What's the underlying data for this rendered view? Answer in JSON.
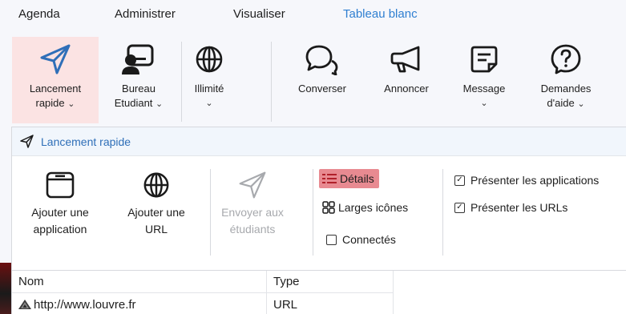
{
  "menu": {
    "agenda": "Agenda",
    "administrer": "Administrer",
    "visualiser": "Visualiser",
    "tableau_blanc": "Tableau blanc"
  },
  "ribbon": {
    "lancement_line1": "Lancement",
    "lancement_line2": "rapide",
    "bureau_line1": "Bureau",
    "bureau_line2": "Etudiant",
    "illimite": "Illimité",
    "converser": "Converser",
    "annoncer": "Annoncer",
    "message": "Message",
    "demandes_line1": "Demandes",
    "demandes_line2": "d'aide",
    "chevron": "⌄"
  },
  "panel": {
    "title": "Lancement rapide",
    "ajouter_app_line1": "Ajouter une",
    "ajouter_app_line2": "application",
    "ajouter_url_line1": "Ajouter une",
    "ajouter_url_line2": "URL",
    "envoyer_line1": "Envoyer aux",
    "envoyer_line2": "étudiants",
    "details": "Détails",
    "larges_icones": "Larges icônes",
    "connectes": "Connectés",
    "presenter_apps": "Présenter les applications",
    "presenter_urls": "Présenter les URLs"
  },
  "table": {
    "headers": [
      "Nom",
      "Type"
    ],
    "rows": [
      {
        "nom": "http://www.louvre.fr",
        "type": "URL"
      }
    ]
  },
  "colors": {
    "accent": "#2f7fd1",
    "selected": "#e88a91",
    "highlight": "#fbe3e3"
  }
}
